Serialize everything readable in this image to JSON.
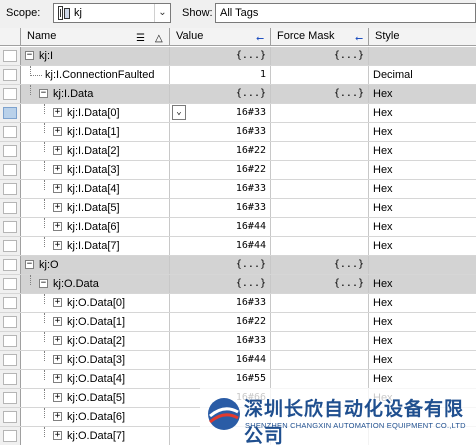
{
  "toolbar": {
    "scope_label": "Scope:",
    "scope_value": "kj",
    "show_label": "Show:",
    "show_value": "All Tags"
  },
  "columns": {
    "name": "Name",
    "value": "Value",
    "force_mask": "Force Mask",
    "style": "Style"
  },
  "rows": [
    {
      "name": "kj:I",
      "value": "{...}",
      "force": "{...}",
      "style": "",
      "level": 0,
      "expander": "minus",
      "group": true
    },
    {
      "name": "kj:I.ConnectionFaulted",
      "value": "1",
      "force": "",
      "style": "Decimal",
      "level": 1,
      "expander": "none",
      "group": false
    },
    {
      "name": "kj:I.Data",
      "value": "{...}",
      "force": "{...}",
      "style": "Hex",
      "level": 1,
      "expander": "minus",
      "group": true
    },
    {
      "name": "kj:I.Data[0]",
      "value": "16#33",
      "force": "",
      "style": "Hex",
      "level": 2,
      "expander": "plus",
      "group": false,
      "active": true
    },
    {
      "name": "kj:I.Data[1]",
      "value": "16#33",
      "force": "",
      "style": "Hex",
      "level": 2,
      "expander": "plus",
      "group": false
    },
    {
      "name": "kj:I.Data[2]",
      "value": "16#22",
      "force": "",
      "style": "Hex",
      "level": 2,
      "expander": "plus",
      "group": false
    },
    {
      "name": "kj:I.Data[3]",
      "value": "16#22",
      "force": "",
      "style": "Hex",
      "level": 2,
      "expander": "plus",
      "group": false
    },
    {
      "name": "kj:I.Data[4]",
      "value": "16#33",
      "force": "",
      "style": "Hex",
      "level": 2,
      "expander": "plus",
      "group": false
    },
    {
      "name": "kj:I.Data[5]",
      "value": "16#33",
      "force": "",
      "style": "Hex",
      "level": 2,
      "expander": "plus",
      "group": false
    },
    {
      "name": "kj:I.Data[6]",
      "value": "16#44",
      "force": "",
      "style": "Hex",
      "level": 2,
      "expander": "plus",
      "group": false
    },
    {
      "name": "kj:I.Data[7]",
      "value": "16#44",
      "force": "",
      "style": "Hex",
      "level": 2,
      "expander": "plus",
      "group": false
    },
    {
      "name": "kj:O",
      "value": "{...}",
      "force": "{...}",
      "style": "",
      "level": 0,
      "expander": "minus",
      "group": true
    },
    {
      "name": "kj:O.Data",
      "value": "{...}",
      "force": "{...}",
      "style": "Hex",
      "level": 1,
      "expander": "minus",
      "group": true
    },
    {
      "name": "kj:O.Data[0]",
      "value": "16#33",
      "force": "",
      "style": "Hex",
      "level": 2,
      "expander": "plus",
      "group": false
    },
    {
      "name": "kj:O.Data[1]",
      "value": "16#22",
      "force": "",
      "style": "Hex",
      "level": 2,
      "expander": "plus",
      "group": false
    },
    {
      "name": "kj:O.Data[2]",
      "value": "16#33",
      "force": "",
      "style": "Hex",
      "level": 2,
      "expander": "plus",
      "group": false
    },
    {
      "name": "kj:O.Data[3]",
      "value": "16#44",
      "force": "",
      "style": "Hex",
      "level": 2,
      "expander": "plus",
      "group": false
    },
    {
      "name": "kj:O.Data[4]",
      "value": "16#55",
      "force": "",
      "style": "Hex",
      "level": 2,
      "expander": "plus",
      "group": false
    },
    {
      "name": "kj:O.Data[5]",
      "value": "16#66",
      "force": "",
      "style": "Hex",
      "level": 2,
      "expander": "plus",
      "group": false
    },
    {
      "name": "kj:O.Data[6]",
      "value": "",
      "force": "",
      "style": "",
      "level": 2,
      "expander": "plus",
      "group": false
    },
    {
      "name": "kj:O.Data[7]",
      "value": "",
      "force": "",
      "style": "",
      "level": 2,
      "expander": "plus",
      "group": false
    }
  ],
  "watermark": {
    "cn": "深圳长欣自动化设备有限公司",
    "en": "SHENZHEN CHANGXIN AUTOMATION EQUIPMENT CO.,LTD"
  },
  "colors": {
    "group_row": "#d3d3d3",
    "accent": "#1f4f8f"
  }
}
